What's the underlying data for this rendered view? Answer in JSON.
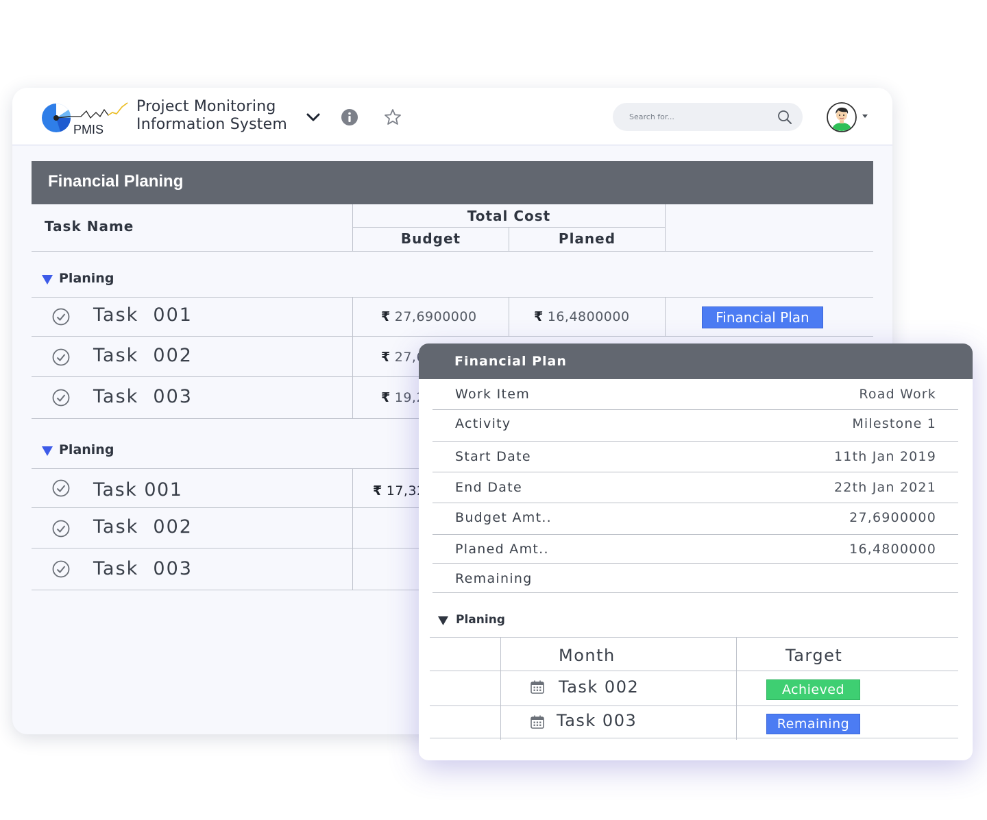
{
  "app": {
    "logo_text": "PMIS",
    "title_line1": "Project Monitoring",
    "title_line2": "Information System"
  },
  "search": {
    "placeholder": "Search for..."
  },
  "panel": {
    "title": "Financial Planing"
  },
  "table": {
    "col_task_name": "Task Name",
    "col_total_cost": "Total Cost",
    "col_budget": "Budget",
    "col_planed": "Planed"
  },
  "currency_symbol": "₹",
  "groups": [
    {
      "label": "Planing",
      "rows": [
        {
          "name": "Task  001",
          "budget": "27,6900000",
          "planed": "16,4800000",
          "action": "Financial Plan"
        },
        {
          "name": "Task  002",
          "budget": "27,6",
          "planed": ""
        },
        {
          "name": "Task  003",
          "budget": "19,2",
          "planed": ""
        }
      ]
    },
    {
      "label": "Planing",
      "rows": [
        {
          "name": "Task 001",
          "budget": "17,32",
          "planed": ""
        },
        {
          "name": "Task  002",
          "budget": "",
          "planed": ""
        },
        {
          "name": "Task  003",
          "budget": "",
          "planed": ""
        }
      ]
    }
  ],
  "popup": {
    "title": "Financial Plan",
    "fields": [
      {
        "label": "Work Item",
        "value": "Road Work"
      },
      {
        "label": "Activity",
        "value": "Milestone 1"
      },
      {
        "label": "Start Date",
        "value": "11th Jan 2019"
      },
      {
        "label": "End Date",
        "value": "22th Jan 2021"
      },
      {
        "label": "Budget Amt..",
        "value": "27,6900000"
      },
      {
        "label": "Planed Amt..",
        "value": "16,4800000"
      },
      {
        "label": "Remaining",
        "value": ""
      }
    ],
    "group_label": "Planing",
    "col_month": "Month",
    "col_target": "Target",
    "rows": [
      {
        "month": "Task 002",
        "target": "Achieved",
        "target_color": "#3ecf72"
      },
      {
        "month": "Task 003",
        "target": "Remaining",
        "target_color": "#4c7cf3"
      }
    ]
  },
  "colors": {
    "header_bar": "#626770",
    "accent_blue": "#4c7cf3",
    "achieved_green": "#3ecf72",
    "group_triangle": "#3d5be8"
  },
  "icons": [
    "chevron-down-icon",
    "info-icon",
    "star-icon",
    "search-icon",
    "avatar-icon",
    "check-circle-icon",
    "calendar-icon",
    "triangle-down-icon"
  ]
}
